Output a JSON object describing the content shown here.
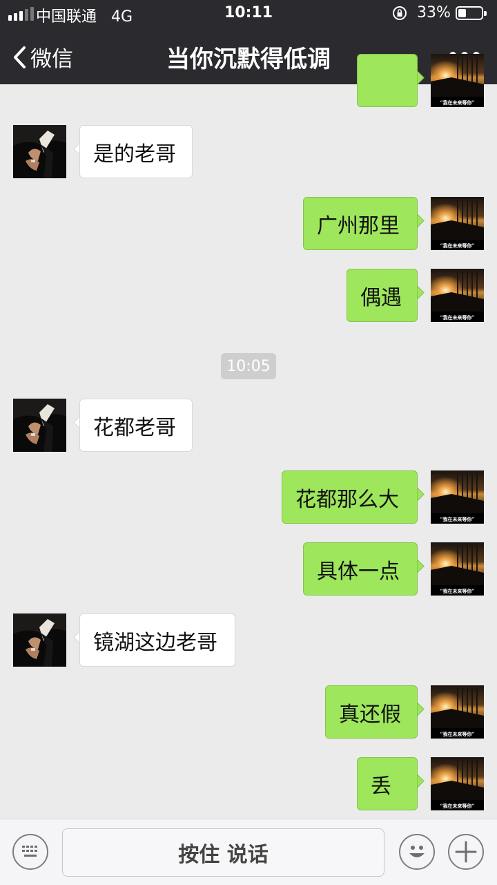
{
  "status_bar": {
    "carrier": "中国联通",
    "network": "4G",
    "time": "10:11",
    "battery": "33%",
    "battery_level": 0.33
  },
  "nav": {
    "back_label": "微信",
    "title": "当你沉默得低调",
    "more_icon": "more-dots-icon"
  },
  "messages": [
    {
      "side": "out",
      "text": "",
      "avatar": "sunset-avatar"
    },
    {
      "side": "in",
      "text": "是的老哥",
      "avatar": "man-suit-avatar"
    },
    {
      "side": "out",
      "text": "广州那里",
      "avatar": "sunset-avatar"
    },
    {
      "side": "out",
      "text": "偶遇",
      "avatar": "sunset-avatar"
    },
    {
      "side": "in",
      "text": "花都老哥",
      "avatar": "man-suit-avatar"
    },
    {
      "side": "out",
      "text": "花都那么大",
      "avatar": "sunset-avatar"
    },
    {
      "side": "out",
      "text": "具体一点",
      "avatar": "sunset-avatar"
    },
    {
      "side": "in",
      "text": "镜湖这边老哥",
      "avatar": "man-suit-avatar"
    },
    {
      "side": "out",
      "text": "真还假",
      "avatar": "sunset-avatar"
    },
    {
      "side": "out",
      "text": "丢",
      "avatar": "sunset-avatar"
    }
  ],
  "timestamp": "10:05",
  "sunset_avatar_caption": "“我在未来等你”",
  "input_bar": {
    "voice_label": "按住 说话",
    "keyboard_icon": "keyboard-icon",
    "emoji_icon": "emoji-icon",
    "add_icon": "plus-icon"
  },
  "colors": {
    "nav_bg": "#2b2b2f",
    "chat_bg": "#ebebeb",
    "out_bubble": "#9ee65b",
    "in_bubble": "#ffffff"
  }
}
